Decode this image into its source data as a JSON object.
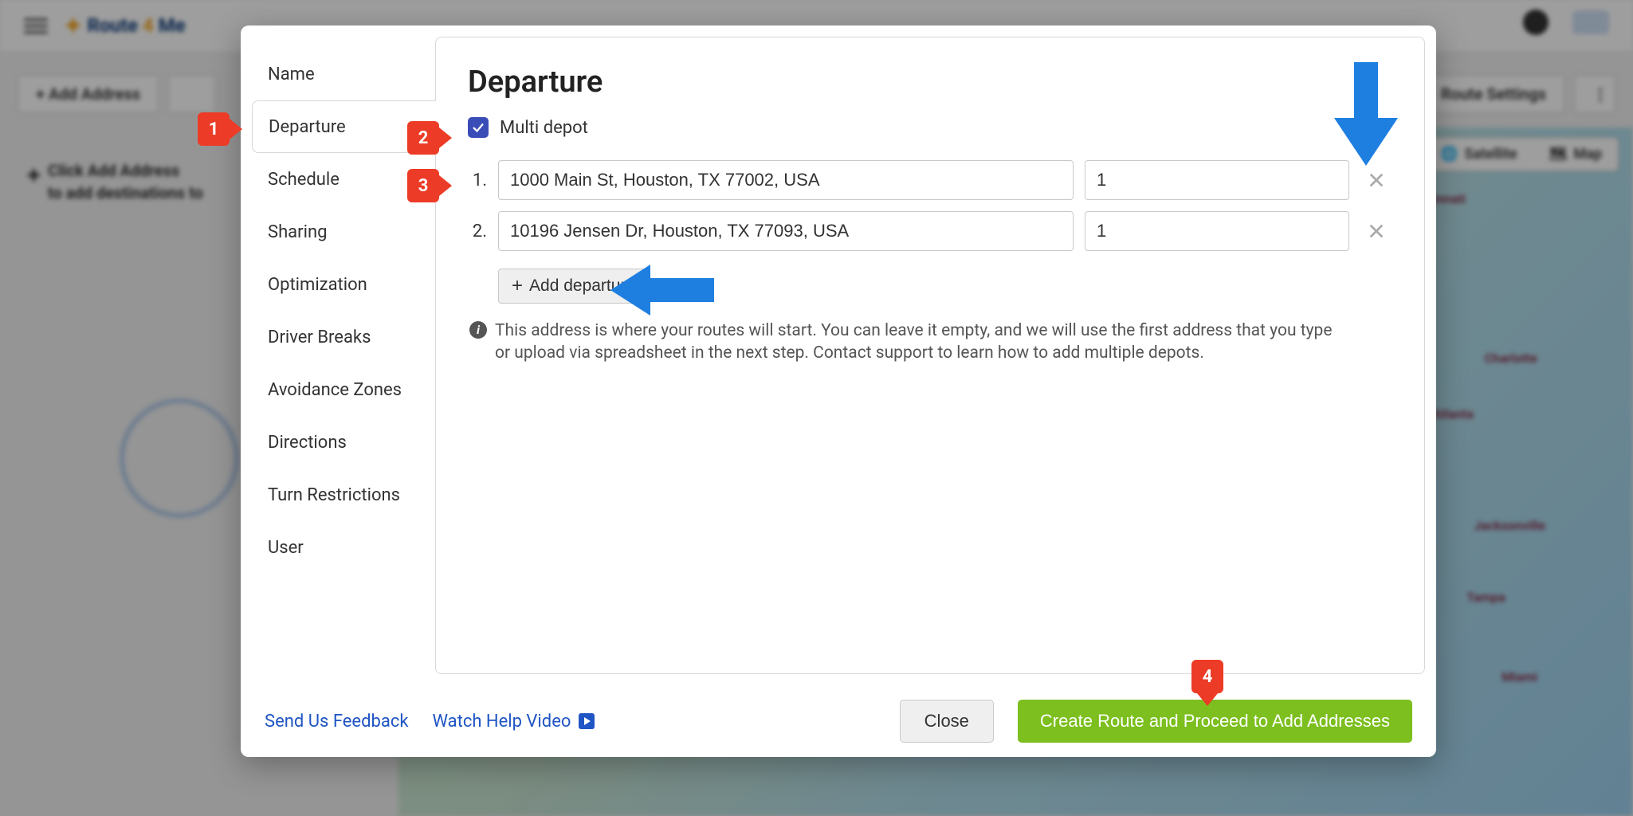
{
  "app": {
    "brand_left": "Route",
    "brand_right": "Me",
    "add_address_label": "+  Add Address",
    "route_settings_label": "Route Settings",
    "hint_line1": "Click Add Address",
    "hint_line2": "to add destinations to",
    "map_toggle": {
      "satellite": "Satellite",
      "map": "Map"
    },
    "cities": [
      "Cincinnati",
      "Charlotte",
      "Atlanta",
      "Jacksonville",
      "Tampa",
      "Miami"
    ]
  },
  "modal": {
    "sidebar": {
      "items": [
        {
          "label": "Name"
        },
        {
          "label": "Departure"
        },
        {
          "label": "Schedule"
        },
        {
          "label": "Sharing"
        },
        {
          "label": "Optimization"
        },
        {
          "label": "Driver Breaks"
        },
        {
          "label": "Avoidance Zones"
        },
        {
          "label": "Directions"
        },
        {
          "label": "Turn Restrictions"
        },
        {
          "label": "User"
        }
      ],
      "active_index": 1
    },
    "panel": {
      "title": "Departure",
      "multi_depot_label": "Multi depot",
      "multi_depot_checked": true,
      "departures": [
        {
          "num": "1.",
          "address": "1000 Main St, Houston, TX 77002, USA",
          "count": "1"
        },
        {
          "num": "2.",
          "address": "10196 Jensen Dr, Houston, TX 77093, USA",
          "count": "1"
        }
      ],
      "add_departure_label": "Add departure",
      "info_text": "This address is where your routes will start. You can leave it empty, and we will use the first address that you type or upload via spreadsheet in the next step. Contact support to learn how to add multiple depots."
    },
    "footer": {
      "feedback": "Send Us Feedback",
      "help_video": "Watch Help Video",
      "close": "Close",
      "primary": "Create Route and Proceed to Add Addresses"
    }
  },
  "annotations": {
    "c1": "1",
    "c2": "2",
    "c3": "3",
    "c4": "4"
  }
}
